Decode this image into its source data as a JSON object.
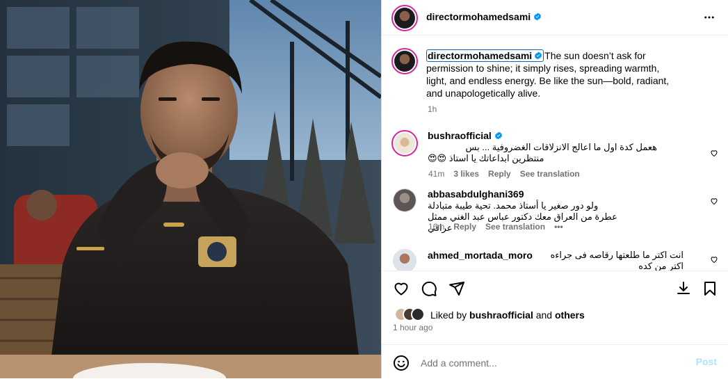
{
  "header": {
    "username": "directormohamedsami",
    "more_icon": "more-horizontal-icon"
  },
  "caption": {
    "username": "directormohamedsami",
    "text": "The sun doesn’t ask for permission to shine; it simply rises, spreading warmth, light, and endless energy. Be like the sun—bold, radiant, and unapologetically alive.",
    "time": "1h"
  },
  "comments": [
    {
      "username": "bushraofficial",
      "verified": true,
      "text_line1": "هعمل كدة اول ما اعالج الانزلاقات الغضروفية ... بس",
      "text_line2": "منتظرين ابداعاتك يا استاذ",
      "emoji": "😍😍",
      "time": "41m",
      "likes": "3 likes",
      "reply": "Reply",
      "translate": "See translation"
    },
    {
      "username": "abbasabdulghani369",
      "verified": false,
      "text_line1": "ولو دور صغير يا أستاذ محمد. تحية طيبة متبادلة",
      "text_line2": "عطرة من العراق معك دكتور عباس عبد الغني ممثل عراقي",
      "time": "16m",
      "reply": "Reply",
      "translate": "See translation",
      "more": "•••"
    },
    {
      "username": "ahmed_mortada_moro",
      "verified": false,
      "text_line1": "انت اكتر ما طلعتها رقاصه فى جراءه اكتر من كده"
    }
  ],
  "actions": {
    "like_icon": "heart-icon",
    "comment_icon": "comment-icon",
    "share_icon": "send-icon",
    "download_icon": "download-icon",
    "save_icon": "bookmark-icon"
  },
  "likes": {
    "prefix": "Liked by",
    "user": "bushraofficial",
    "and": "and",
    "others": "others"
  },
  "time_ago": "1 hour ago",
  "add_comment": {
    "placeholder": "Add a comment...",
    "post_label": "Post",
    "emoji_icon": "smiley-icon"
  },
  "colors": {
    "verified": "#0095f6",
    "secondary_text": "#737373",
    "post_disabled": "#b2dffc",
    "caption_highlight": "#0a66c2"
  }
}
